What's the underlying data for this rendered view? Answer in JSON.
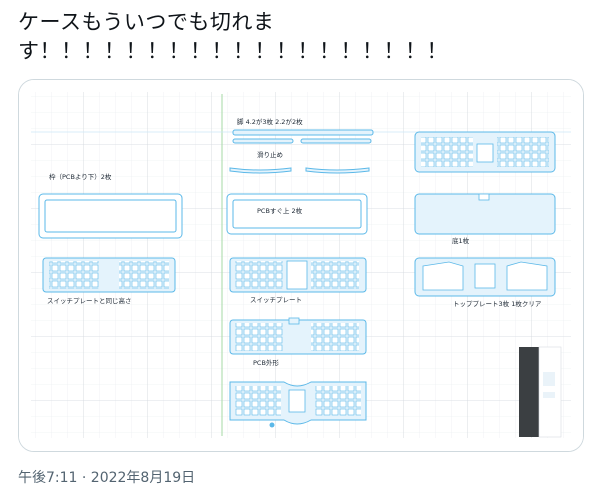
{
  "tweet": {
    "text_line1": "ケースもういつでも切れま",
    "text_line2": "す！！！！！！！！！！！！！！！！！！！",
    "timestamp": "午後7:11 · 2022年8月19日"
  },
  "media": {
    "labels": {
      "legs": "脚 4.2が3枚 2.2が2枚",
      "antislip": "滑り止め",
      "frame": "枠（PCBより下）2枚",
      "pcb_just_above": "PCBすぐ上 2枚",
      "bottom": "底1枚",
      "switch_plate_same_height": "スイッチプレートと同じ高さ",
      "switch_plate": "スイッチプレート",
      "top_plate": "トッププレート3枚 1枚クリア",
      "pcb_outline": "PCB外形"
    },
    "colors": {
      "outline": "#5bb8e8",
      "fill": "#e4f3fc",
      "grid": "#e2e6ea",
      "grid_major": "#cfd5da",
      "green_line": "#9fd39f"
    }
  }
}
